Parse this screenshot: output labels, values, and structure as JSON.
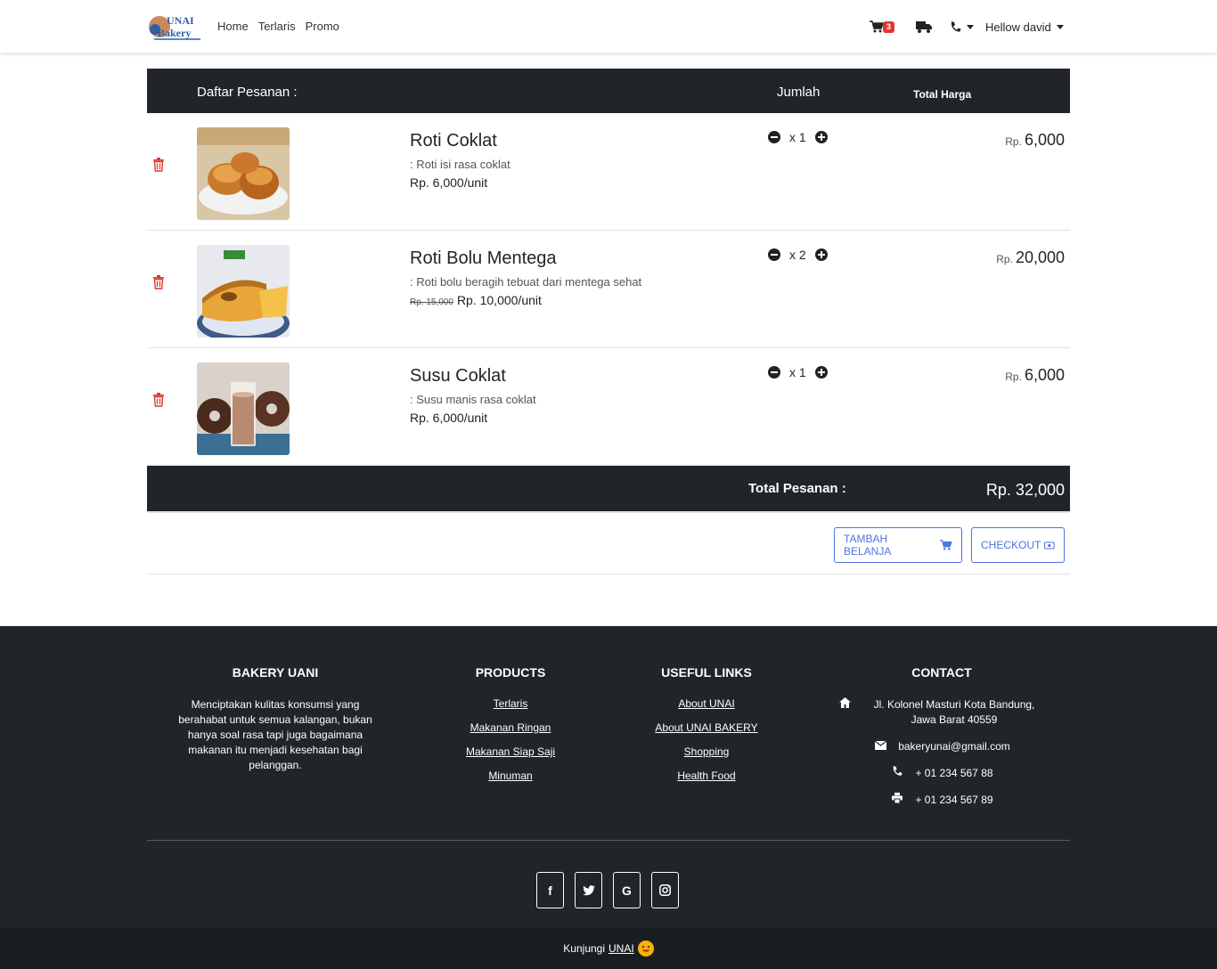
{
  "brand": {
    "logo_text_top": "UNAI",
    "logo_text_bottom": "Bakery"
  },
  "nav": {
    "links": [
      "Home",
      "Terlaris",
      "Promo"
    ],
    "cart_count": "3",
    "user": "Hellow david"
  },
  "table": {
    "headers": {
      "order": "Daftar Pesanan :",
      "qty": "Jumlah",
      "total": "Total Harga"
    },
    "rows": [
      {
        "name": "Roti Coklat",
        "desc": ": Roti isi rasa coklat",
        "old_price": "",
        "price": "Rp. 6,000/unit",
        "qty": "x 1",
        "rp": "Rp.",
        "total": "6,000"
      },
      {
        "name": "Roti Bolu Mentega",
        "desc": ": Roti bolu beragih tebuat dari mentega sehat",
        "old_price": "Rp. 15,000",
        "price": "Rp. 10,000/unit",
        "qty": "x 2",
        "rp": "Rp.",
        "total": "20,000"
      },
      {
        "name": "Susu Coklat",
        "desc": ": Susu manis rasa coklat",
        "old_price": "",
        "price": "Rp. 6,000/unit",
        "qty": "x 1",
        "rp": "Rp.",
        "total": "6,000"
      }
    ],
    "footer": {
      "label": "Total Pesanan :",
      "value": "Rp. 32,000"
    }
  },
  "actions": {
    "continue": "TAMBAH BELANJA",
    "checkout": "CHECKOUT"
  },
  "footer": {
    "about": {
      "title": "BAKERY UANI",
      "text": "Menciptakan kulitas konsumsi yang berahabat untuk semua kalangan, bukan hanya soal rasa tapi juga bagaimana makanan itu menjadi kesehatan bagi pelanggan."
    },
    "products": {
      "title": "PRODUCTS",
      "links": [
        "Terlaris",
        "Makanan Ringan",
        "Makanan Siap Saji",
        "Minuman"
      ]
    },
    "useful": {
      "title": "USEFUL LINKS",
      "links": [
        "About UNAI",
        "About UNAI BAKERY",
        "Shopping",
        "Health Food"
      ]
    },
    "contact": {
      "title": "CONTACT",
      "address": "Jl. Kolonel Masturi Kota Bandung, Jawa Barat 40559",
      "email": "bakeryunai@gmail.com",
      "phone": "+ 01 234 567 88",
      "fax": "+ 01 234 567 89"
    },
    "social": [
      "f",
      "t",
      "G",
      "ig"
    ],
    "copy": {
      "prefix": "Kunjungi",
      "link": "UNAI"
    }
  },
  "colors": {
    "dark": "#212529",
    "accent": "#4e73df",
    "danger": "#e3342f"
  },
  "icons": [
    "cart-icon",
    "truck-icon",
    "phone-icon",
    "trash-icon",
    "minus-circle-icon",
    "plus-circle-icon",
    "money-icon",
    "home-icon",
    "envelope-icon",
    "printer-icon",
    "facebook-icon",
    "twitter-icon",
    "google-icon",
    "instagram-icon",
    "smile-icon"
  ]
}
